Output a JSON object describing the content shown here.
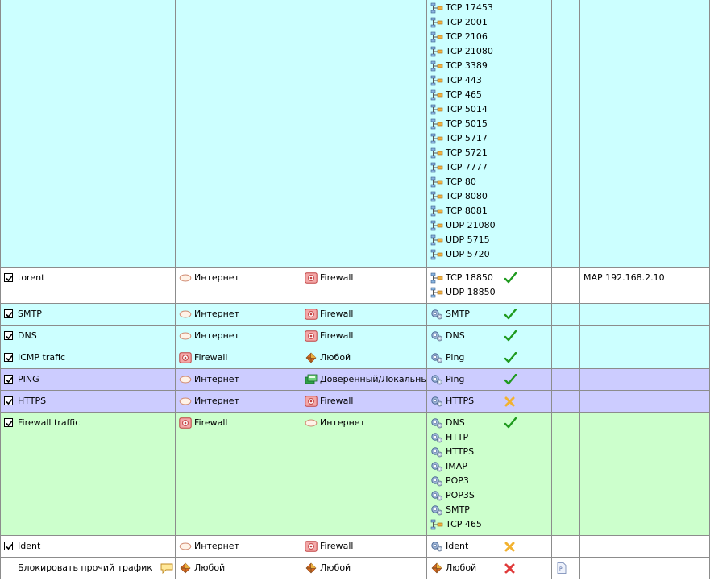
{
  "colors": {
    "cyan": "#ccffff",
    "white": "#ffffff",
    "lavender": "#ccccff",
    "green": "#ccffcc",
    "grid": "#8c8c8c"
  },
  "rows": [
    {
      "id": "top-continued",
      "bg": "cyan",
      "checked": null,
      "name": "",
      "comment": false,
      "source": null,
      "dest": null,
      "services": [
        {
          "icon": "port",
          "label": "TCP 17453"
        },
        {
          "icon": "port",
          "label": "TCP 2001"
        },
        {
          "icon": "port",
          "label": "TCP 2106"
        },
        {
          "icon": "port",
          "label": "TCP 21080"
        },
        {
          "icon": "port",
          "label": "TCP 3389"
        },
        {
          "icon": "port",
          "label": "TCP 443"
        },
        {
          "icon": "port",
          "label": "TCP 465"
        },
        {
          "icon": "port",
          "label": "TCP 5014"
        },
        {
          "icon": "port",
          "label": "TCP 5015"
        },
        {
          "icon": "port",
          "label": "TCP 5717"
        },
        {
          "icon": "port",
          "label": "TCP 5721"
        },
        {
          "icon": "port",
          "label": "TCP 7777"
        },
        {
          "icon": "port",
          "label": "TCP 80"
        },
        {
          "icon": "port",
          "label": "TCP 8080"
        },
        {
          "icon": "port",
          "label": "TCP 8081"
        },
        {
          "icon": "port",
          "label": "UDP 21080"
        },
        {
          "icon": "port",
          "label": "UDP 5715"
        },
        {
          "icon": "port",
          "label": "UDP 5720"
        }
      ],
      "action": null,
      "log": false,
      "translation": ""
    },
    {
      "id": "torent",
      "bg": "white",
      "checked": true,
      "name": "torent",
      "comment": false,
      "source": {
        "icon": "cloud",
        "label": "Интернет"
      },
      "dest": {
        "icon": "firewall",
        "label": "Firewall"
      },
      "services": [
        {
          "icon": "port",
          "label": "TCP 18850"
        },
        {
          "icon": "port",
          "label": "UDP 18850"
        }
      ],
      "action": "allow",
      "log": false,
      "translation": "MAP 192.168.2.10"
    },
    {
      "id": "smtp",
      "bg": "cyan",
      "checked": true,
      "name": "SMTP",
      "comment": false,
      "source": {
        "icon": "cloud",
        "label": "Интернет"
      },
      "dest": {
        "icon": "firewall",
        "label": "Firewall"
      },
      "services": [
        {
          "icon": "gear",
          "label": "SMTP"
        }
      ],
      "action": "allow",
      "log": false,
      "translation": ""
    },
    {
      "id": "dns",
      "bg": "cyan",
      "checked": true,
      "name": "DNS",
      "comment": false,
      "source": {
        "icon": "cloud",
        "label": "Интернет"
      },
      "dest": {
        "icon": "firewall",
        "label": "Firewall"
      },
      "services": [
        {
          "icon": "gear",
          "label": "DNS"
        }
      ],
      "action": "allow",
      "log": false,
      "translation": ""
    },
    {
      "id": "icmp",
      "bg": "cyan",
      "checked": true,
      "name": "ICMP trafic",
      "comment": false,
      "source": {
        "icon": "firewall",
        "label": "Firewall"
      },
      "dest": {
        "icon": "any",
        "label": "Любой"
      },
      "services": [
        {
          "icon": "gear",
          "label": "Ping"
        }
      ],
      "action": "allow",
      "log": false,
      "translation": ""
    },
    {
      "id": "ping",
      "bg": "lavender",
      "checked": true,
      "name": "PING",
      "comment": false,
      "source": {
        "icon": "cloud",
        "label": "Интернет"
      },
      "dest": {
        "icon": "trusted",
        "label": "Доверенный/Локальный"
      },
      "services": [
        {
          "icon": "gear",
          "label": "Ping"
        }
      ],
      "action": "allow",
      "log": false,
      "translation": ""
    },
    {
      "id": "https",
      "bg": "lavender",
      "checked": true,
      "name": "HTTPS",
      "comment": false,
      "source": {
        "icon": "cloud",
        "label": "Интернет"
      },
      "dest": {
        "icon": "firewall",
        "label": "Firewall"
      },
      "services": [
        {
          "icon": "gear",
          "label": "HTTPS"
        }
      ],
      "action": "drop",
      "log": false,
      "translation": ""
    },
    {
      "id": "fwtraffic",
      "bg": "green",
      "checked": true,
      "name": "Firewall traffic",
      "comment": false,
      "source": {
        "icon": "firewall",
        "label": "Firewall"
      },
      "dest": {
        "icon": "cloud",
        "label": "Интернет"
      },
      "services": [
        {
          "icon": "gear",
          "label": "DNS"
        },
        {
          "icon": "gear",
          "label": "HTTP"
        },
        {
          "icon": "gear",
          "label": "HTTPS"
        },
        {
          "icon": "gear",
          "label": "IMAP"
        },
        {
          "icon": "gear",
          "label": "POP3"
        },
        {
          "icon": "gear",
          "label": "POP3S"
        },
        {
          "icon": "gear",
          "label": "SMTP"
        },
        {
          "icon": "port",
          "label": "TCP 465"
        }
      ],
      "action": "allow",
      "log": false,
      "translation": ""
    },
    {
      "id": "ident",
      "bg": "white",
      "checked": true,
      "name": "Ident",
      "comment": false,
      "source": {
        "icon": "cloud",
        "label": "Интернет"
      },
      "dest": {
        "icon": "firewall",
        "label": "Firewall"
      },
      "services": [
        {
          "icon": "gear",
          "label": "Ident"
        }
      ],
      "action": "drop",
      "log": false,
      "translation": ""
    },
    {
      "id": "block",
      "bg": "white",
      "checked": null,
      "name": "Блокировать прочий трафик",
      "comment": true,
      "source": {
        "icon": "any",
        "label": "Любой"
      },
      "dest": {
        "icon": "any",
        "label": "Любой"
      },
      "services": [
        {
          "icon": "any",
          "label": "Любой"
        }
      ],
      "action": "deny",
      "log": true,
      "translation": ""
    }
  ]
}
